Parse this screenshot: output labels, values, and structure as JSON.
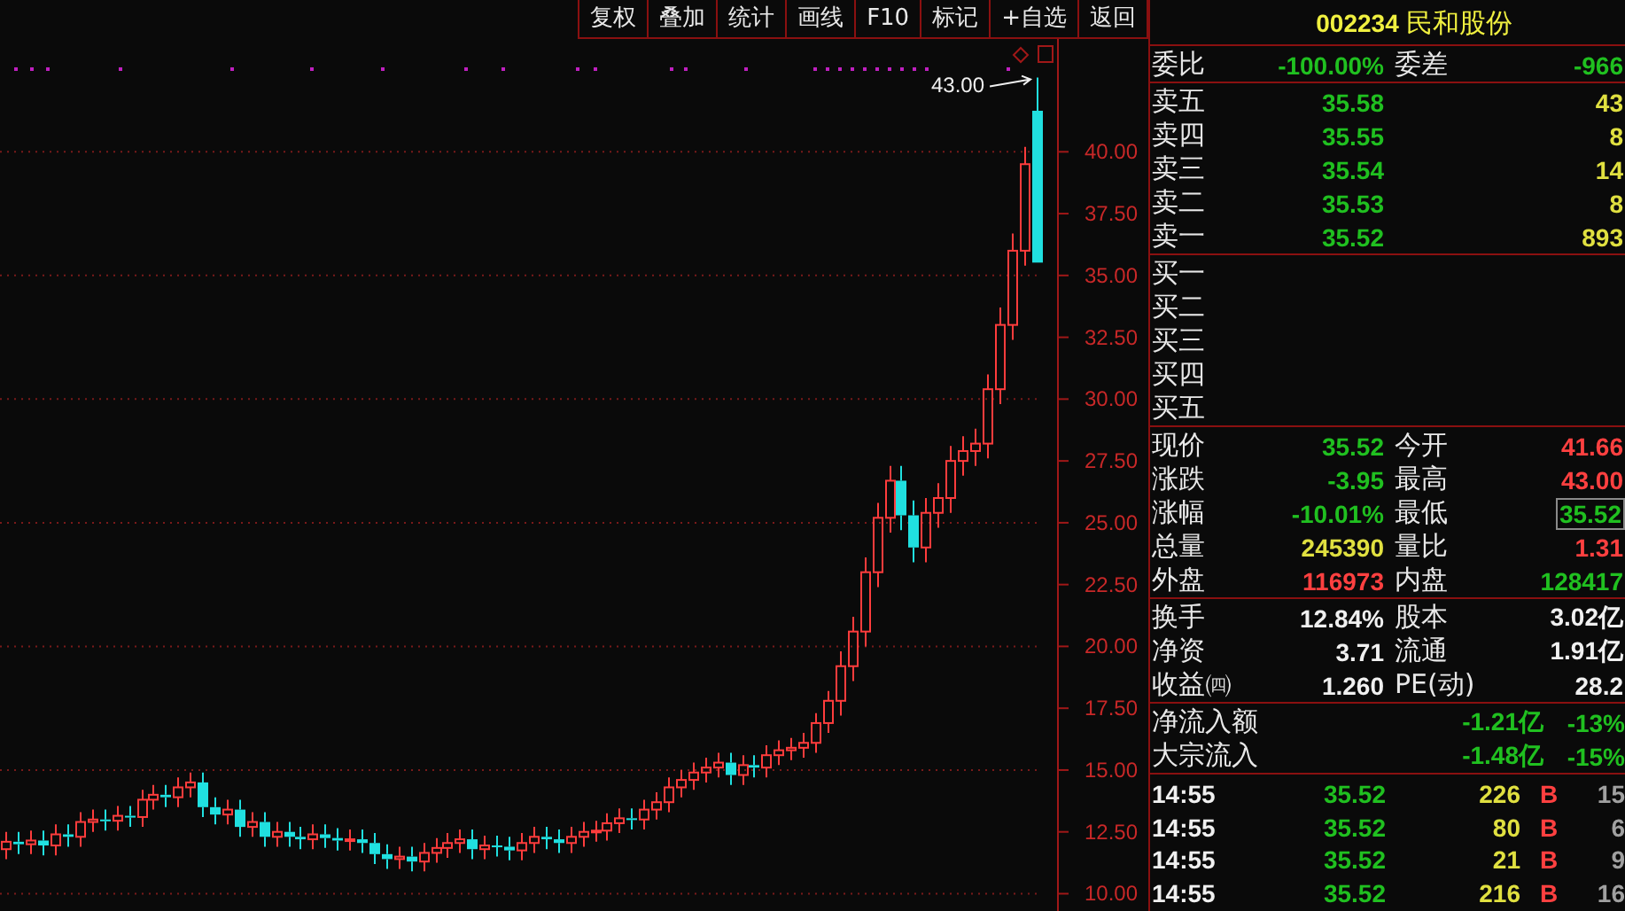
{
  "toolbar": {
    "buttons": [
      "复权",
      "叠加",
      "统计",
      "画线",
      "F10",
      "标记",
      "+自选",
      "返回"
    ]
  },
  "chart": {
    "chart_data": {
      "type": "candlestick",
      "grid": true,
      "annotations": [
        "43.00"
      ],
      "categories": [
        null,
        null,
        null,
        null,
        null,
        null,
        null,
        null,
        null,
        null,
        null,
        null,
        null,
        null,
        null,
        null,
        null,
        null,
        null,
        null,
        null,
        null,
        null,
        null,
        null,
        null,
        null,
        null,
        null,
        null,
        null,
        null,
        null,
        null,
        null,
        null,
        null,
        null,
        null,
        null,
        null,
        null,
        null,
        null,
        null,
        null,
        null,
        null,
        null,
        null,
        null,
        null,
        null,
        null,
        null,
        null,
        null,
        null,
        null,
        null,
        null,
        null,
        null,
        null,
        null,
        null,
        null,
        null,
        null,
        null,
        null,
        null,
        null,
        null,
        null,
        null,
        null,
        null,
        null,
        null,
        null,
        null,
        null,
        null,
        null
      ],
      "ohlc": [
        [
          11.8,
          12.5,
          11.4,
          12.1
        ],
        [
          12.1,
          12.5,
          11.6,
          12.0
        ],
        [
          12.0,
          12.55,
          11.6,
          12.15
        ],
        [
          12.15,
          12.55,
          11.55,
          11.95
        ],
        [
          11.95,
          12.8,
          11.55,
          12.4
        ],
        [
          12.4,
          12.8,
          11.9,
          12.3
        ],
        [
          12.3,
          13.3,
          11.9,
          12.9
        ],
        [
          12.9,
          13.4,
          12.5,
          13.0
        ],
        [
          13.0,
          13.4,
          12.55,
          12.95
        ],
        [
          12.95,
          13.55,
          12.55,
          13.15
        ],
        [
          13.15,
          13.55,
          12.7,
          13.1
        ],
        [
          13.1,
          14.2,
          12.7,
          13.8
        ],
        [
          13.8,
          14.4,
          13.4,
          14.0
        ],
        [
          14.0,
          14.4,
          13.5,
          13.9
        ],
        [
          13.9,
          14.7,
          13.5,
          14.3
        ],
        [
          14.3,
          14.9,
          13.9,
          14.5
        ],
        [
          14.5,
          14.9,
          13.1,
          13.5
        ],
        [
          13.5,
          13.9,
          12.8,
          13.2
        ],
        [
          13.2,
          13.8,
          12.8,
          13.4
        ],
        [
          13.4,
          13.8,
          12.3,
          12.7
        ],
        [
          12.7,
          13.3,
          12.3,
          12.9
        ],
        [
          12.9,
          13.3,
          11.9,
          12.3
        ],
        [
          12.3,
          12.9,
          11.9,
          12.5
        ],
        [
          12.5,
          12.9,
          11.9,
          12.3
        ],
        [
          12.3,
          12.7,
          11.8,
          12.2
        ],
        [
          12.2,
          12.8,
          11.8,
          12.4
        ],
        [
          12.4,
          12.8,
          11.85,
          12.25
        ],
        [
          12.25,
          12.65,
          11.75,
          12.15
        ],
        [
          12.15,
          12.6,
          11.75,
          12.2
        ],
        [
          12.2,
          12.6,
          11.65,
          12.05
        ],
        [
          12.05,
          12.45,
          11.2,
          11.6
        ],
        [
          11.6,
          12.0,
          11.0,
          11.4
        ],
        [
          11.4,
          11.9,
          11.0,
          11.5
        ],
        [
          11.5,
          11.9,
          10.9,
          11.3
        ],
        [
          11.3,
          12.05,
          10.9,
          11.65
        ],
        [
          11.65,
          12.25,
          11.25,
          11.85
        ],
        [
          11.85,
          12.45,
          11.45,
          12.05
        ],
        [
          12.05,
          12.6,
          11.65,
          12.2
        ],
        [
          12.2,
          12.6,
          11.4,
          11.8
        ],
        [
          11.8,
          12.35,
          11.4,
          11.95
        ],
        [
          11.95,
          12.35,
          11.5,
          11.9
        ],
        [
          11.9,
          12.3,
          11.35,
          11.75
        ],
        [
          11.75,
          12.45,
          11.35,
          12.05
        ],
        [
          12.05,
          12.7,
          11.65,
          12.3
        ],
        [
          12.3,
          12.7,
          11.8,
          12.2
        ],
        [
          12.2,
          12.6,
          11.65,
          12.05
        ],
        [
          12.05,
          12.7,
          11.65,
          12.3
        ],
        [
          12.3,
          12.9,
          11.9,
          12.5
        ],
        [
          12.5,
          12.95,
          12.1,
          12.55
        ],
        [
          12.55,
          13.25,
          12.15,
          12.85
        ],
        [
          12.85,
          13.45,
          12.45,
          13.05
        ],
        [
          13.05,
          13.45,
          12.6,
          13.0
        ],
        [
          13.0,
          13.8,
          12.6,
          13.4
        ],
        [
          13.4,
          14.1,
          13.0,
          13.7
        ],
        [
          13.7,
          14.7,
          13.3,
          14.3
        ],
        [
          14.3,
          15.0,
          13.9,
          14.6
        ],
        [
          14.6,
          15.3,
          14.2,
          14.9
        ],
        [
          14.9,
          15.5,
          14.5,
          15.1
        ],
        [
          15.1,
          15.7,
          14.7,
          15.3
        ],
        [
          15.3,
          15.7,
          14.4,
          14.8
        ],
        [
          14.8,
          15.6,
          14.4,
          15.2
        ],
        [
          15.2,
          15.6,
          14.7,
          15.1
        ],
        [
          15.1,
          16.0,
          14.7,
          15.6
        ],
        [
          15.6,
          16.2,
          15.2,
          15.8
        ],
        [
          15.8,
          16.3,
          15.4,
          15.9
        ],
        [
          15.9,
          16.5,
          15.5,
          16.1
        ],
        [
          16.1,
          17.3,
          15.7,
          16.9
        ],
        [
          16.9,
          18.2,
          16.5,
          17.8
        ],
        [
          17.8,
          19.8,
          17.2,
          19.2
        ],
        [
          19.2,
          21.2,
          18.6,
          20.6
        ],
        [
          20.6,
          23.6,
          20.0,
          23.0
        ],
        [
          23.0,
          25.8,
          22.4,
          25.2
        ],
        [
          25.2,
          27.3,
          24.6,
          26.7
        ],
        [
          26.7,
          27.3,
          24.7,
          25.3
        ],
        [
          25.3,
          25.9,
          23.4,
          24.0
        ],
        [
          24.0,
          26.0,
          23.4,
          25.4
        ],
        [
          25.4,
          26.6,
          24.8,
          26.0
        ],
        [
          26.0,
          28.1,
          25.4,
          27.5
        ],
        [
          27.5,
          28.5,
          26.9,
          27.9
        ],
        [
          27.9,
          28.8,
          27.3,
          28.2
        ],
        [
          28.2,
          31.0,
          27.6,
          30.4
        ],
        [
          30.4,
          33.7,
          29.8,
          33.0
        ],
        [
          33.0,
          36.7,
          32.4,
          36.0
        ],
        [
          36.0,
          40.2,
          35.4,
          39.5
        ],
        [
          41.66,
          43.0,
          35.52,
          35.52
        ]
      ],
      "ylim": [
        9.3,
        43.2
      ],
      "yticks": [
        {
          "value": 40,
          "label": "40.00"
        },
        {
          "value": 37.5,
          "label": "37.50"
        },
        {
          "value": 35,
          "label": "35.00"
        },
        {
          "value": 32.5,
          "label": "32.50"
        },
        {
          "value": 30,
          "label": "30.00"
        },
        {
          "value": 27.5,
          "label": "27.50"
        },
        {
          "value": 25,
          "label": "25.00"
        },
        {
          "value": 22.5,
          "label": "22.50"
        },
        {
          "value": 20,
          "label": "20.00"
        },
        {
          "value": 17.5,
          "label": "17.50"
        },
        {
          "value": 15,
          "label": "15.00"
        },
        {
          "value": 12.5,
          "label": "12.50"
        },
        {
          "value": 10,
          "label": "10.00"
        }
      ]
    }
  },
  "quote_panel": {
    "code": "002234",
    "name": "民和股份",
    "order_ratio": {
      "label": "委比",
      "value": {
        "text": "-100.00%",
        "color": "#20c020"
      },
      "label2": "委差",
      "value2": {
        "text": "-966",
        "color": "#20c020"
      }
    },
    "asks": [
      {
        "label": "卖五",
        "price": "35.58",
        "volume": "43"
      },
      {
        "label": "卖四",
        "price": "35.55",
        "volume": "8"
      },
      {
        "label": "卖三",
        "price": "35.54",
        "volume": "14"
      },
      {
        "label": "卖二",
        "price": "35.53",
        "volume": "8"
      },
      {
        "label": "卖一",
        "price": "35.52",
        "volume": "893"
      }
    ],
    "bids": [
      {
        "label": "买一"
      },
      {
        "label": "买二"
      },
      {
        "label": "买三"
      },
      {
        "label": "买四"
      },
      {
        "label": "买五"
      }
    ],
    "stats": [
      {
        "label": "现价",
        "value": {
          "text": "35.52",
          "color": "#20c020"
        },
        "label2": "今开",
        "value2": {
          "text": "41.66",
          "color": "#ff4040",
          "boxed": false
        }
      },
      {
        "label": "涨跌",
        "value": {
          "text": "-3.95",
          "color": "#20c020"
        },
        "label2": "最高",
        "value2": {
          "text": "43.00",
          "color": "#ff4040",
          "boxed": false
        }
      },
      {
        "label": "涨幅",
        "value": {
          "text": "-10.01%",
          "color": "#20c020"
        },
        "label2": "最低",
        "value2": {
          "text": "35.52",
          "color": "#20c020",
          "boxed": true
        }
      },
      {
        "label": "总量",
        "value": {
          "text": "245390",
          "color": "#e0e040"
        },
        "label2": "量比",
        "value2": {
          "text": "1.31",
          "color": "#ff4040",
          "boxed": false
        }
      },
      {
        "label": "外盘",
        "value": {
          "text": "116973",
          "color": "#ff4040"
        },
        "label2": "内盘",
        "value2": {
          "text": "128417",
          "color": "#20c020",
          "boxed": false
        }
      }
    ],
    "fundamentals": [
      {
        "label": "换手",
        "value": "12.84%",
        "label2": "股本",
        "value2": "3.02亿"
      },
      {
        "label": "净资",
        "value": "3.71",
        "label2": "流通",
        "value2": "1.91亿"
      },
      {
        "label": "收益㈣",
        "value": "1.260",
        "label2": "PE(动)",
        "value2": "28.2"
      }
    ],
    "flows": [
      {
        "label": "净流入额",
        "amount": "-1.21亿",
        "percent": "-13%"
      },
      {
        "label": "大宗流入",
        "amount": "-1.48亿",
        "percent": "-15%"
      }
    ],
    "ticks": [
      {
        "time": "14:55",
        "price": "35.52",
        "volume": "226",
        "side": "B",
        "count": "15"
      },
      {
        "time": "14:55",
        "price": "35.52",
        "volume": "80",
        "side": "B",
        "count": "6"
      },
      {
        "time": "14:55",
        "price": "35.52",
        "volume": "21",
        "side": "B",
        "count": "9"
      },
      {
        "time": "14:55",
        "price": "35.52",
        "volume": "216",
        "side": "B",
        "count": "16"
      }
    ]
  }
}
